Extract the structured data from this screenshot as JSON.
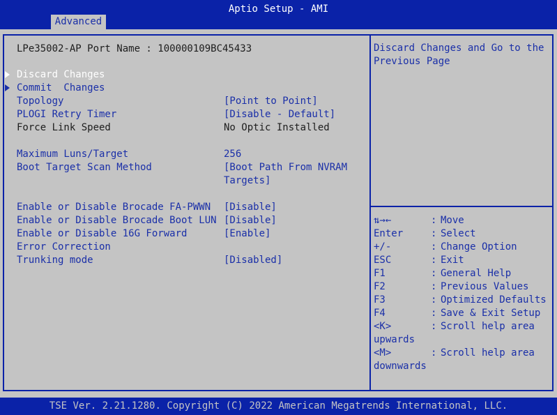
{
  "header": {
    "title": "Aptio Setup - AMI",
    "tab_label": "Advanced"
  },
  "port_name": "LPe35002-AP Port Name : 100000109BC45433",
  "settings": {
    "discard_changes": "Discard Changes",
    "commit_changes": "Commit  Changes",
    "topology_label": "Topology",
    "topology_value": "[Point to Point]",
    "plogi_label": "PLOGI Retry Timer",
    "plogi_value": "[Disable - Default]",
    "force_link_label": "Force Link Speed",
    "force_link_value": "No Optic Installed",
    "max_luns_label": "Maximum Luns/Target",
    "max_luns_value": "256",
    "boot_scan_label": "Boot Target Scan Method",
    "boot_scan_value_line1": "[Boot Path From NVRAM",
    "boot_scan_value_line2": "Targets]",
    "fa_pwwn_label": "Enable or Disable Brocade FA-PWWN",
    "fa_pwwn_value": "[Disable]",
    "boot_lun_label": "Enable or Disable Brocade Boot LUN",
    "boot_lun_value": "[Disable]",
    "fwd16g_label": "Enable or Disable 16G Forward",
    "fwd16g_value": "[Enable]",
    "error_correction_label": "Error Correction",
    "trunking_label": "Trunking mode",
    "trunking_value": "[Disabled]"
  },
  "help": {
    "line1": "Discard Changes and Go to the",
    "line2": "Previous Page"
  },
  "keys": [
    {
      "key": "⇅→←",
      "sep": ":",
      "desc": "Move"
    },
    {
      "key": "Enter",
      "sep": ":",
      "desc": "Select"
    },
    {
      "key": "+/-",
      "sep": ":",
      "desc": "Change Option"
    },
    {
      "key": "ESC",
      "sep": ":",
      "desc": "Exit"
    },
    {
      "key": "F1",
      "sep": ":",
      "desc": "General Help"
    },
    {
      "key": "F2",
      "sep": ":",
      "desc": "Previous Values"
    },
    {
      "key": "F3",
      "sep": ":",
      "desc": "Optimized Defaults"
    },
    {
      "key": "F4",
      "sep": ":",
      "desc": "Save & Exit Setup"
    },
    {
      "key": "<K>",
      "sep": ":",
      "desc": "Scroll help area",
      "cont": "upwards"
    },
    {
      "key": "<M>",
      "sep": ":",
      "desc": "Scroll help area",
      "cont": "downwards"
    }
  ],
  "footer": "TSE Ver. 2.21.1280. Copyright (C) 2022 American Megatrends International, LLC.",
  "colors": {
    "bios_blue": "#0a22a8",
    "panel_gray": "#c4c4c4",
    "link_blue": "#1a2fa8",
    "selected_white": "#ffffff"
  }
}
